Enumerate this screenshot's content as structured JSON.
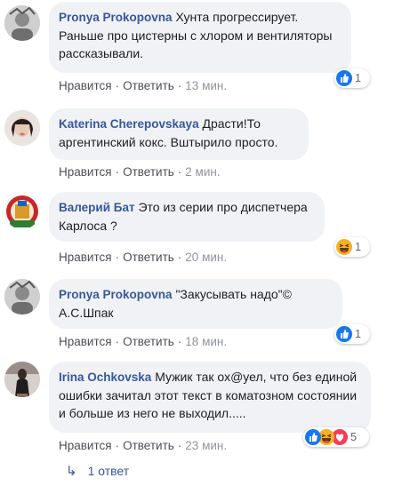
{
  "comments": [
    {
      "author": "Pronya Prokopovna",
      "text": "Хунта прогрессирует. Раньше про цистерны с хлором и вентиляторы рассказывали.",
      "like": "Нравится",
      "reply": "Ответить",
      "time": "13 мин.",
      "reaction_count": "1",
      "reactions": [
        "like-icon"
      ]
    },
    {
      "author": "Katerina Cherepovskaya",
      "text": "Драсти!То аргентинский кокс. Вштырило просто.",
      "like": "Нравится",
      "reply": "Ответить",
      "time": "2 мин."
    },
    {
      "author": "Валерий Бат",
      "text": "Это из серии про диспетчера Карлоса ?",
      "like": "Нравится",
      "reply": "Ответить",
      "time": "20 мин.",
      "reaction_count": "1",
      "reactions": [
        "haha-icon"
      ]
    },
    {
      "author": "Pronya Prokopovna",
      "text": "\"Закусывать надо\"© А.С.Шпак",
      "like": "Нравится",
      "reply": "Ответить",
      "time": "18 мин.",
      "reaction_count": "1",
      "reactions": [
        "like-icon"
      ]
    },
    {
      "author": "Irina Ochkovska",
      "text": "Мужик так ох@уел, что без единой ошибки зачитал этот текст в коматозном состоянии и больше из него не выходил.....",
      "like": "Нравится",
      "reply": "Ответить",
      "time": "23 мин.",
      "reaction_count": "5",
      "reactions": [
        "like-icon",
        "haha-icon",
        "love-icon"
      ]
    }
  ],
  "replies_link": "1 ответ",
  "colors": {
    "author": "#385898",
    "bubble": "#f0f2f5",
    "like": "#1877f2",
    "haha": "#f7b125",
    "love": "#f33e58"
  }
}
